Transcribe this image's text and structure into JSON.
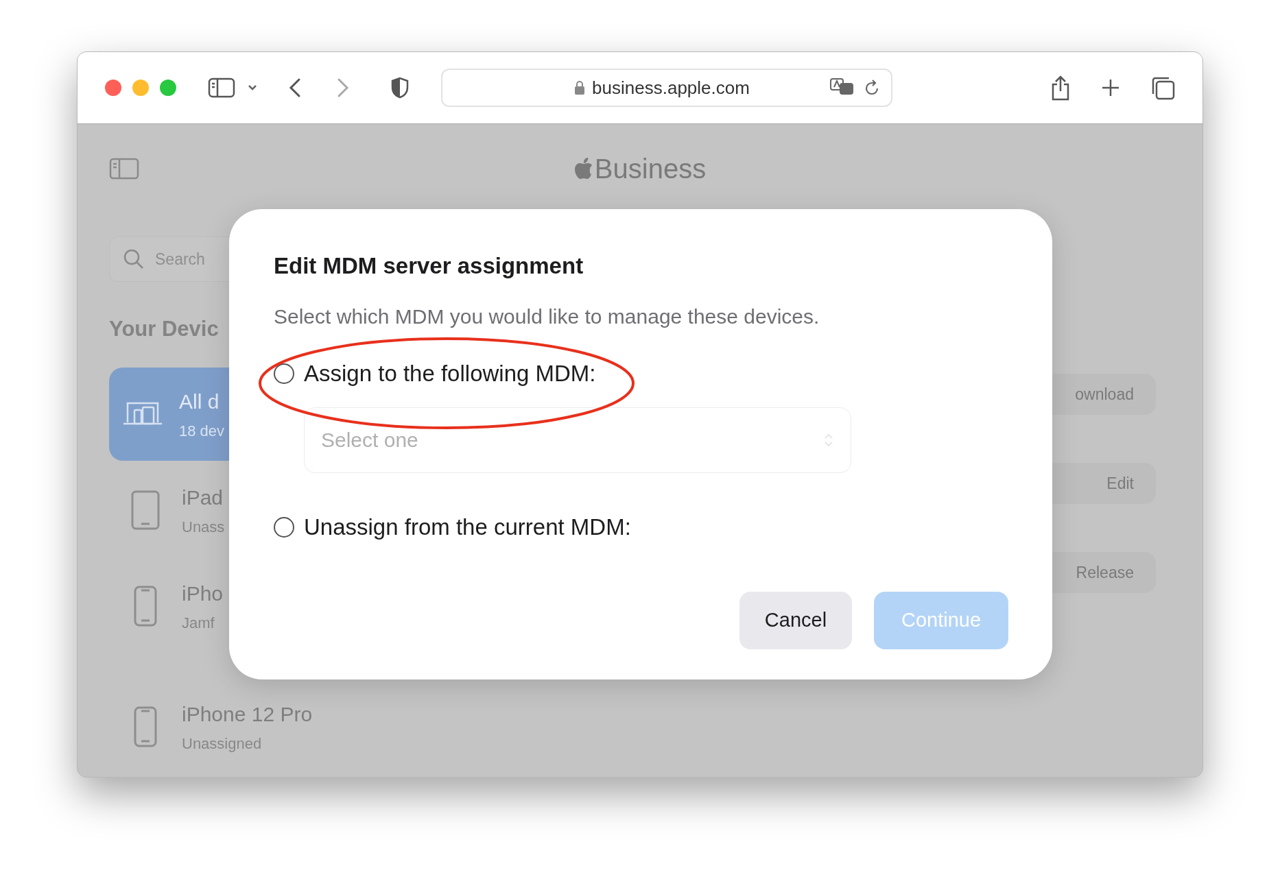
{
  "browser": {
    "url": "business.apple.com"
  },
  "header": {
    "logo_text": "Business"
  },
  "sidebar": {
    "search": {
      "placeholder": "Search"
    },
    "section_title": "Your Devic",
    "items": [
      {
        "name": "All d",
        "detail": "18 dev",
        "selected": true,
        "kind": "all"
      },
      {
        "name": "iPad",
        "detail": "Unass",
        "selected": false,
        "kind": "ipad"
      },
      {
        "name": "iPho",
        "detail": "Jamf",
        "selected": false,
        "kind": "iphone"
      },
      {
        "name": "iPhone 12 Pro",
        "detail": "Unassigned",
        "selected": false,
        "kind": "iphone"
      }
    ]
  },
  "actions": [
    "ownload",
    "Edit",
    "Release"
  ],
  "dialog": {
    "title": "Edit MDM server assignment",
    "description": "Select which MDM you would like to manage these devices.",
    "options": [
      {
        "label": "Assign to the following MDM:",
        "selected": false,
        "field": {
          "placeholder": "Select one",
          "disabled": true
        }
      },
      {
        "label": "Unassign from the current MDM:",
        "selected": false
      }
    ],
    "buttons": [
      {
        "label": "Cancel",
        "kind": "secondary",
        "disabled": false
      },
      {
        "label": "Continue",
        "kind": "primary",
        "disabled": true
      }
    ]
  }
}
